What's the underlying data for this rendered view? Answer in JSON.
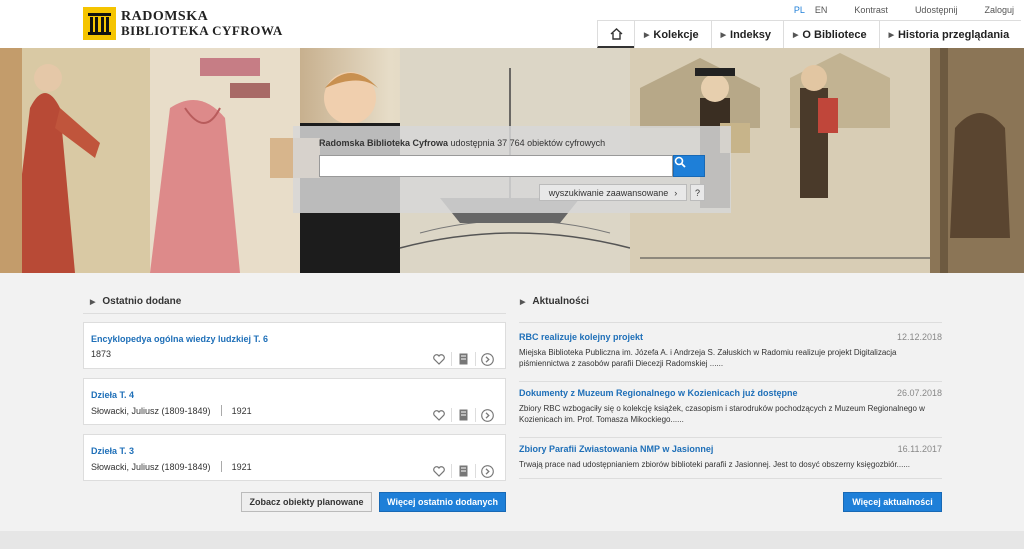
{
  "brand": {
    "line1": "RADOMSKA",
    "line2": "BIBLIOTEKA CYFROWA"
  },
  "topbar": {
    "lang_pl": "PL",
    "lang_en": "EN",
    "contrast": "Kontrast",
    "share": "Udostępnij",
    "login": "Zaloguj"
  },
  "nav": {
    "home_icon": "home-icon",
    "items": [
      {
        "label": "Kolekcje"
      },
      {
        "label": "Indeksy"
      },
      {
        "label": "O Bibliotece"
      },
      {
        "label": "Historia przeglądania"
      }
    ]
  },
  "search": {
    "caption_bold": "Radomska Biblioteka Cyfrowa",
    "caption_rest": " udostępnia 37 764 obiektów cyfrowych",
    "value": "",
    "advanced_label": "wyszukiwanie zaawansowane",
    "advanced_arrow": "›",
    "help_label": "?"
  },
  "recent": {
    "title": "Ostatnio dodane",
    "items": [
      {
        "title": "Encyklopedya ogólna wiedzy ludzkiej T. 6",
        "author": "",
        "year": "1873"
      },
      {
        "title": "Dzieła T. 4",
        "author": "Słowacki, Juliusz (1809-1849)",
        "year": "1921"
      },
      {
        "title": "Dzieła T. 3",
        "author": "Słowacki, Juliusz (1809-1849)",
        "year": "1921"
      }
    ],
    "planned_button": "Zobacz obiekty planowane",
    "more_button": "Więcej ostatnio dodanych"
  },
  "news": {
    "title": "Aktualności",
    "items": [
      {
        "title": "RBC realizuje kolejny projekt",
        "date": "12.12.2018",
        "body": "Miejska Biblioteka Publiczna im. Józefa A. i Andrzeja S. Załuskich w Radomiu realizuje projekt Digitalizacja piśmiennictwa z zasobów parafii Diecezji Radomskiej ......"
      },
      {
        "title": "Dokumenty z Muzeum Regionalnego w Kozienicach już dostępne",
        "date": "26.07.2018",
        "body": "Zbiory RBC wzbogaciły się o kolekcję książek, czasopism i starodruków pochodzących z Muzeum Regionalnego w Kozienicach im. Prof. Tomasza Mikockiego......"
      },
      {
        "title": "Zbiory Parafii Zwiastowania NMP w Jasionnej",
        "date": "16.11.2017",
        "body": "Trwają prace nad udostępnianiem zbiorów biblioteki parafii z Jasionnej. Jest to dosyć obszerny księgozbiór......"
      }
    ],
    "more_button": "Więcej aktualności"
  },
  "colors": {
    "accent": "#1e7fd8",
    "link": "#1e6fb8",
    "logo_yellow": "#f5c400"
  }
}
